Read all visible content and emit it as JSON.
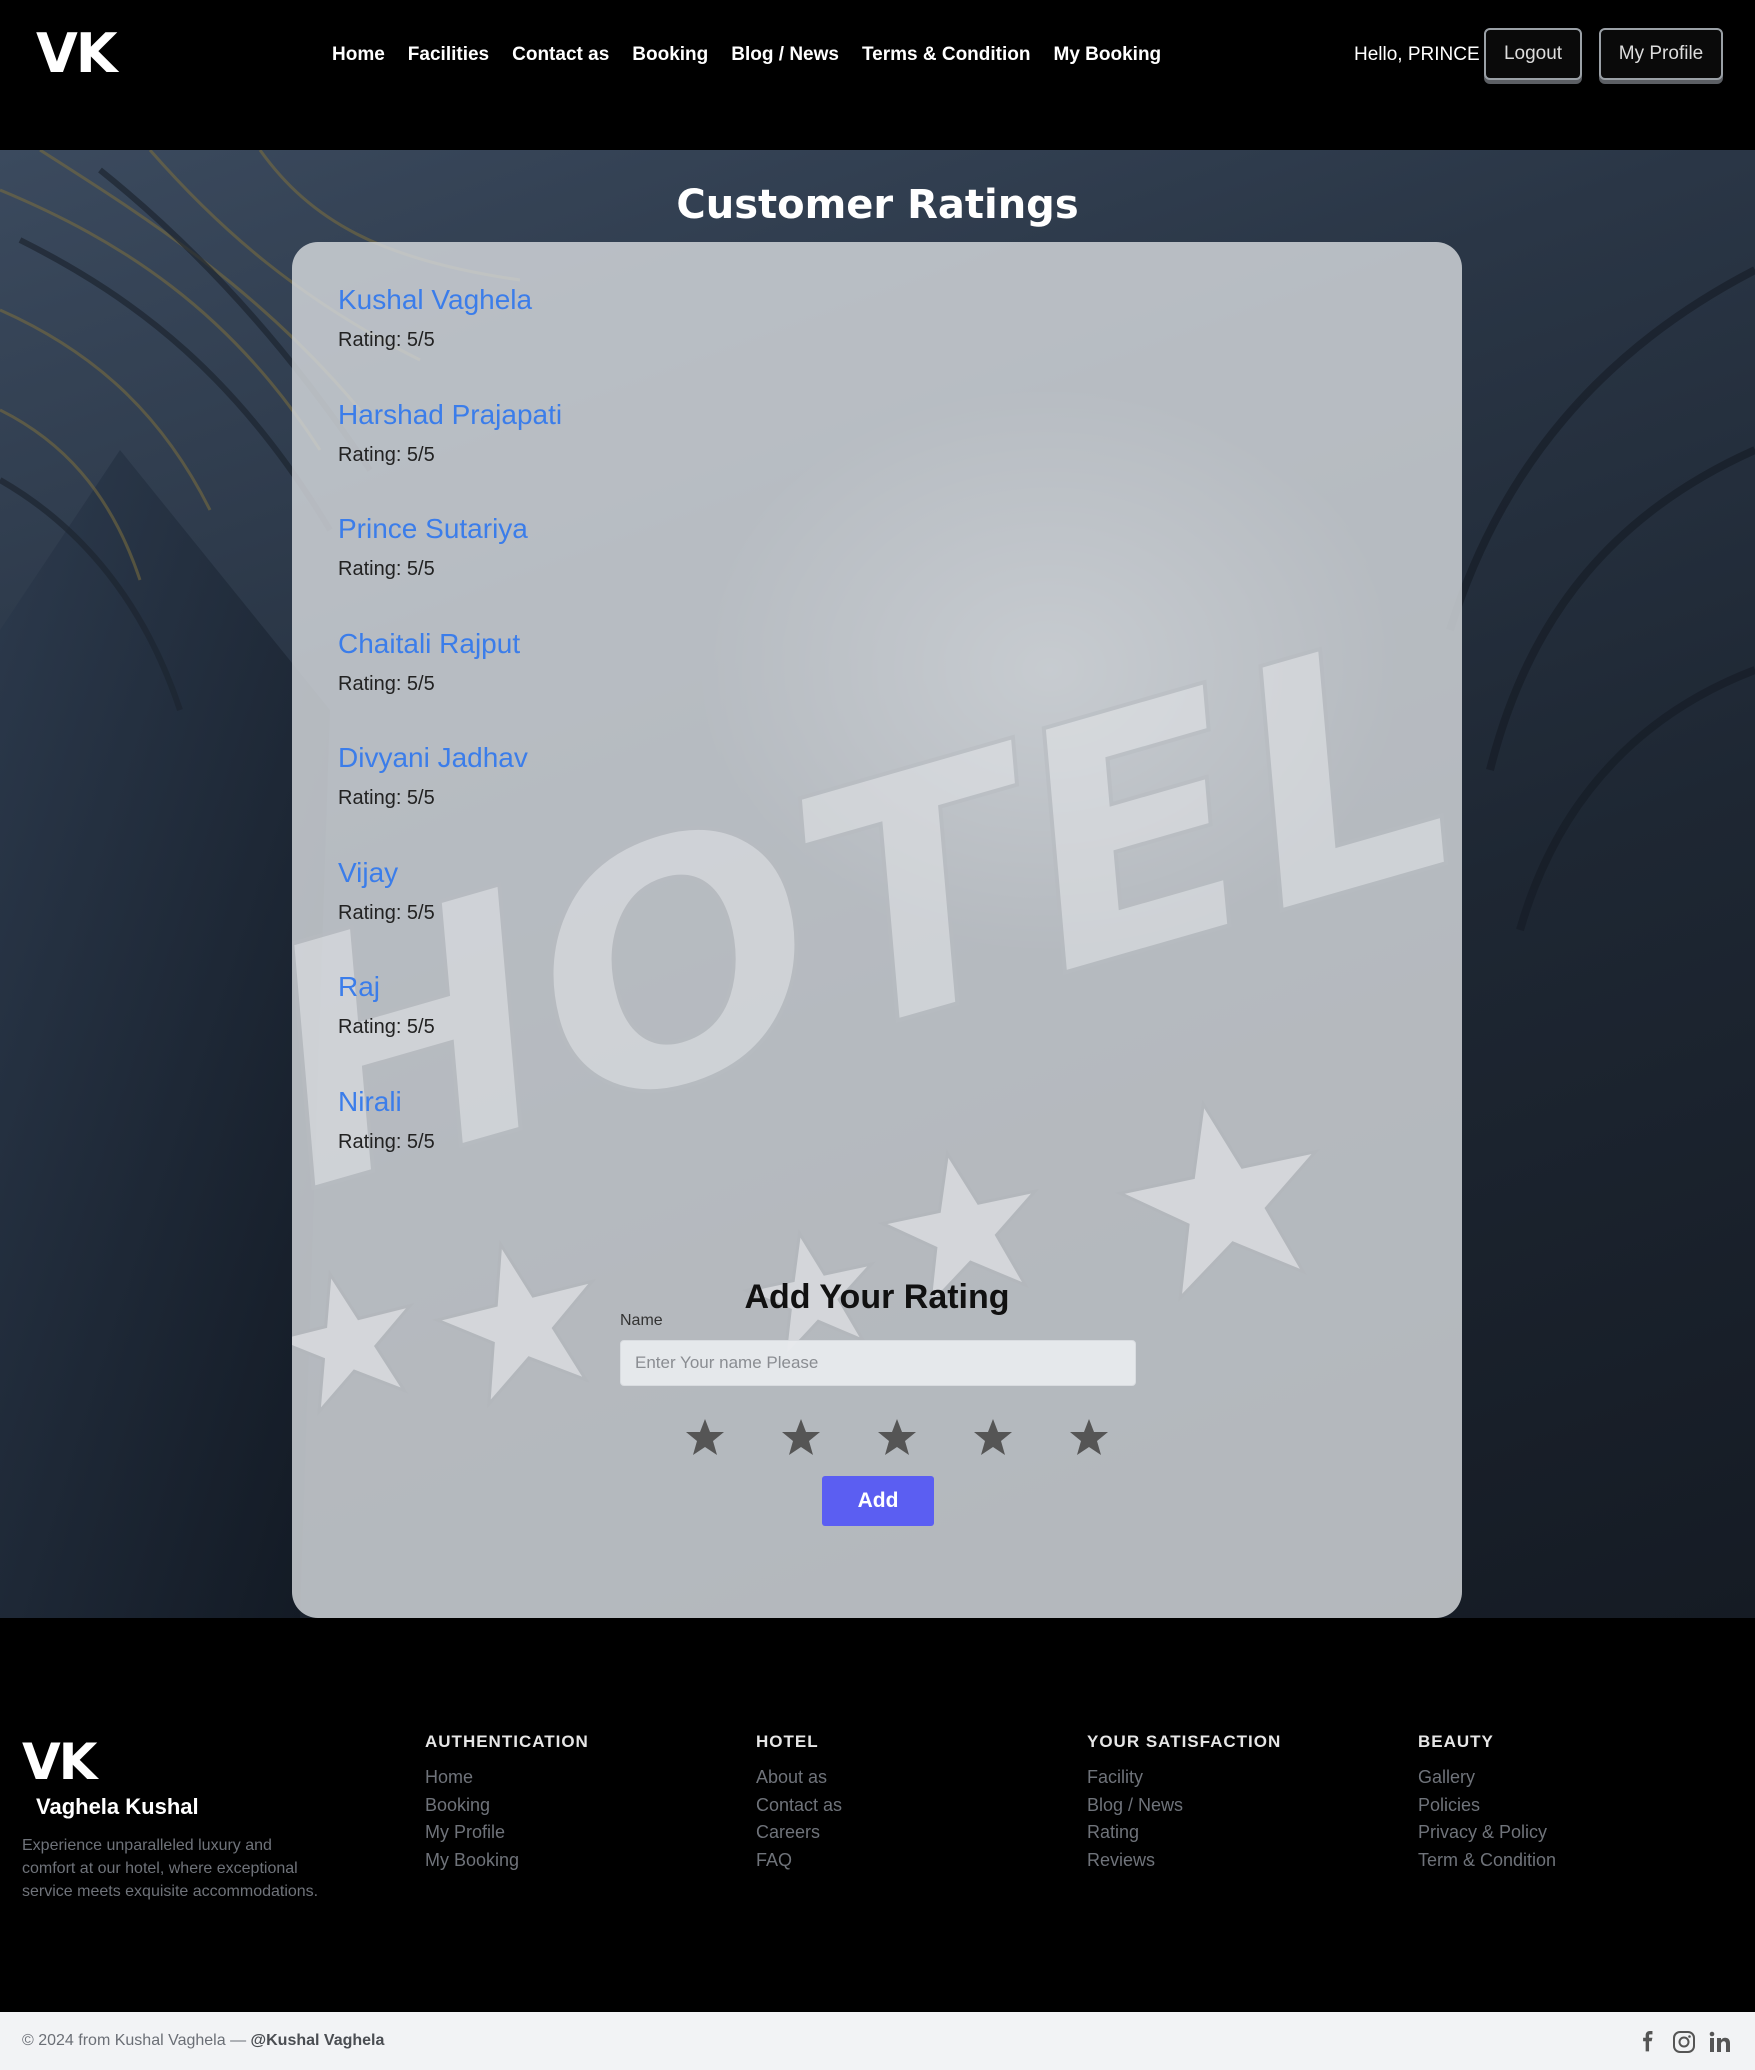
{
  "nav": {
    "brand": "VK",
    "links": [
      "Home",
      "Facilities",
      "Contact as",
      "Booking",
      "Blog / News",
      "Terms & Condition",
      "My Booking"
    ],
    "greeting": "Hello, PRINCE",
    "logout_label": "Logout",
    "profile_label": "My Profile"
  },
  "page": {
    "title": "Customer Ratings"
  },
  "ratings": [
    {
      "name": "Kushal Vaghela",
      "rating": "Rating: 5/5"
    },
    {
      "name": "Harshad Prajapati",
      "rating": "Rating: 5/5"
    },
    {
      "name": "Prince Sutariya",
      "rating": "Rating: 5/5"
    },
    {
      "name": "Chaitali Rajput",
      "rating": "Rating: 5/5"
    },
    {
      "name": "Divyani Jadhav",
      "rating": "Rating: 5/5"
    },
    {
      "name": "Vijay",
      "rating": "Rating: 5/5"
    },
    {
      "name": "Raj",
      "rating": "Rating: 5/5"
    },
    {
      "name": "Nirali",
      "rating": "Rating: 5/5"
    }
  ],
  "form": {
    "title": "Add Your Rating",
    "name_label": "Name",
    "name_placeholder": "Enter Your name Please",
    "name_value": "",
    "star_count": 5,
    "add_label": "Add"
  },
  "watermark": {
    "text": "HOTEL"
  },
  "footer": {
    "brand": "VK",
    "subtitle": "Vaghela Kushal",
    "description": "Experience unparalleled luxury and comfort at our hotel, where exceptional service meets exquisite accommodations.",
    "columns": [
      {
        "title": "AUTHENTICATION",
        "links": [
          "Home",
          "Booking",
          "My Profile",
          "My Booking"
        ]
      },
      {
        "title": "HOTEL",
        "links": [
          "About as",
          "Contact as",
          "Careers",
          "FAQ"
        ]
      },
      {
        "title": "YOUR SATISFACTION",
        "links": [
          "Facility",
          "Blog / News",
          "Rating",
          "Reviews"
        ]
      },
      {
        "title": "BEAUTY",
        "links": [
          "Gallery",
          "Policies",
          "Privacy & Policy",
          "Term & Condition"
        ]
      }
    ],
    "copyright": "© 2024 from Kushal Vaghela —",
    "copyright_handle": "@Kushal Vaghela",
    "social_icons": [
      "facebook-icon",
      "instagram-icon",
      "linkedin-icon"
    ]
  },
  "colors": {
    "accent": "#5b5ef2",
    "name_link": "#3b7dea",
    "star": "#555555"
  }
}
